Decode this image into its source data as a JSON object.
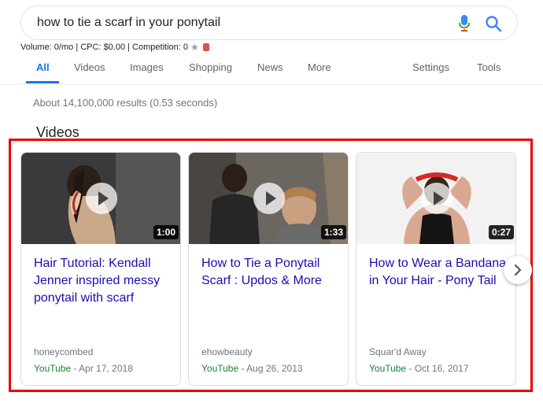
{
  "search": {
    "query": "how to tie a scarf in your ponytail"
  },
  "seo_bar": {
    "text": "Volume: 0/mo | CPC: $0.00 | Competition: 0"
  },
  "tabs": [
    {
      "label": "All",
      "active": true
    },
    {
      "label": "Videos"
    },
    {
      "label": "Images"
    },
    {
      "label": "Shopping"
    },
    {
      "label": "News"
    },
    {
      "label": "More"
    },
    {
      "label": "Settings"
    },
    {
      "label": "Tools"
    }
  ],
  "result_stats": "About 14,100,000 results (0.53 seconds)",
  "videos_section": {
    "title": "Videos",
    "cards": [
      {
        "title": "Hair Tutorial: Kendall Jenner inspired messy ponytail with scarf",
        "duration": "1:00",
        "channel": "honeycombed",
        "source": "YouTube",
        "date": " - Apr 17, 2018"
      },
      {
        "title": "How to Tie a Ponytail Scarf : Updos & More",
        "duration": "1:33",
        "channel": "ehowbeauty",
        "source": "YouTube",
        "date": " - Aug 26, 2013"
      },
      {
        "title": "How to Wear a Bandana in Your Hair - Pony Tail",
        "duration": "0:27",
        "channel": "Squar'd Away",
        "source": "YouTube",
        "date": " - Oct 16, 2017"
      }
    ]
  },
  "colors": {
    "link": "#1a0dab",
    "active_tab": "#1a73e8",
    "source_green": "#188038",
    "highlight": "#ee0000"
  }
}
